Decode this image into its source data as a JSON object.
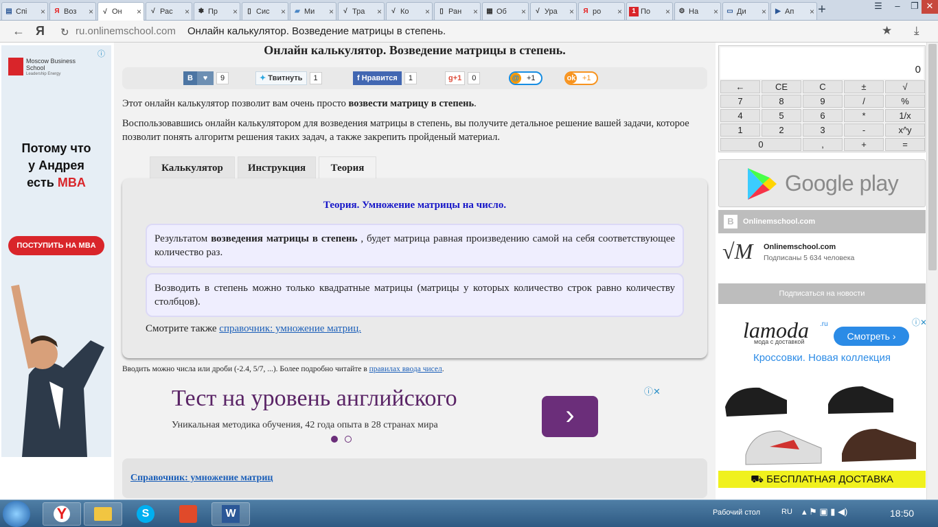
{
  "browser": {
    "tabs": [
      {
        "label": "Спі",
        "icon": "doc-icon"
      },
      {
        "label": "Воз",
        "icon": "yandex-icon"
      },
      {
        "label": "Он",
        "icon": "matrix-site-icon"
      },
      {
        "label": "Рас",
        "icon": "matrix-site-icon"
      },
      {
        "label": "Пр",
        "icon": "flower-icon"
      },
      {
        "label": "Сис",
        "icon": "page-icon"
      },
      {
        "label": "Ми",
        "icon": "folder-icon"
      },
      {
        "label": "Тра",
        "icon": "matrix-site-icon"
      },
      {
        "label": "Ко",
        "icon": "matrix-site-icon"
      },
      {
        "label": "Ран",
        "icon": "page-icon"
      },
      {
        "label": "Об",
        "icon": "book-icon"
      },
      {
        "label": "Ура",
        "icon": "matrix-site-icon"
      },
      {
        "label": "ро",
        "icon": "yandex-icon"
      },
      {
        "label": "По",
        "icon": "number-one-icon"
      },
      {
        "label": "На",
        "icon": "gear-icon"
      },
      {
        "label": "Ди",
        "icon": "chat-icon"
      },
      {
        "label": "Ап",
        "icon": "play-icon"
      }
    ],
    "address": {
      "yandex_glyph": "Я",
      "url": "ru.onlinemschool.com",
      "title": "Онлайн калькулятор. Возведение матрицы в степень."
    }
  },
  "page": {
    "heading": "Онлайн калькулятор. Возведение матрицы в степень.",
    "share": {
      "vk_letter": "B",
      "vk_count": "9",
      "tweet_label": "Твитнуть",
      "tweet_count": "1",
      "fb_label": "Нравится",
      "fb_count": "1",
      "gplus_label": "+1",
      "gplus_count": "0",
      "mail_label": "+1",
      "ok_label": "+1"
    },
    "intro_plain": "Этот онлайн калькулятор позволит вам очень просто ",
    "intro_bold": "возвести матрицу в степень",
    "intro_end": ".",
    "intro2": "Воспользовавшись онлайн калькулятором для возведения матрицы в степень, вы получите детальное решение вашей задачи, которое позволит понять алгоритм решения таких задач, а также закрепить пройденый материал.",
    "tabs": [
      "Калькулятор",
      "Инструкция",
      "Теория"
    ],
    "theory_title": "Теория. Умножение матрицы на число.",
    "box1_a": "Результатом ",
    "box1_b": "возведения матрицы в степень",
    "box1_c": " , будет матрица равная произведению самой на себя соответствующее количество раз.",
    "box2": "Возводить в степень можно только квадратные матрицы (матрицы у которых количество строк равно количеству столбцов).",
    "see_also": "Смотрите также ",
    "see_also_link": "справочник: умножение матриц.",
    "hint": "Вводить можно числа или дроби (-2.4, 5/7, ...). Более подробно читайте в ",
    "hint_link": "правилах ввода чисел",
    "hint_end": ".",
    "ad_title": "Тест на уровень английского",
    "ad_sub": "Уникальная методика обучения, 42 года опыта в 28 странах мира",
    "ad_arrow": "›",
    "ref_link": "Справочник: умножение матриц"
  },
  "left_ad": {
    "brand": "Moscow Business School",
    "brand_sub": "Leadership Energy",
    "text1": "Потому что",
    "text2": "у Андрея",
    "text3": "есть ",
    "text3_red": "MBA",
    "button": "ПОСТУПИТЬ НА MBA"
  },
  "calculator": {
    "display": "0",
    "keys": [
      [
        "←",
        "CE",
        "C",
        "±",
        "√"
      ],
      [
        "7",
        "8",
        "9",
        "/",
        "%"
      ],
      [
        "4",
        "5",
        "6",
        "*",
        "1/x"
      ],
      [
        "1",
        "2",
        "3",
        "-",
        "x^y"
      ],
      [
        "0",
        ",",
        "+",
        "="
      ]
    ]
  },
  "sidebar": {
    "gplay": "Google play",
    "vk_group": "Onlinemschool.com",
    "vk_name": "Onlinemschool.com",
    "vk_subs": "Подписаны 5 634 человека",
    "vk_button": "Подписаться на новости",
    "lamoda_logo": "lamoda",
    "lamoda_ru": ".ru",
    "lamoda_sub": "мода с доставкой",
    "lamoda_btn": "Смотреть ›",
    "lamoda_text": "Кроссовки. Новая коллекция",
    "lamoda_delivery": "БЕСПЛАТНАЯ ДОСТАВКА"
  },
  "taskbar": {
    "desktop": "Рабочий стол",
    "lang": "RU",
    "time": "18:50"
  },
  "colors": {
    "link": "#1a5eb8",
    "theory_title": "#1515c8",
    "ad_purple": "#6b2e7a",
    "mba_red": "#d9252a",
    "lamoda_blue": "#2b8be6"
  }
}
